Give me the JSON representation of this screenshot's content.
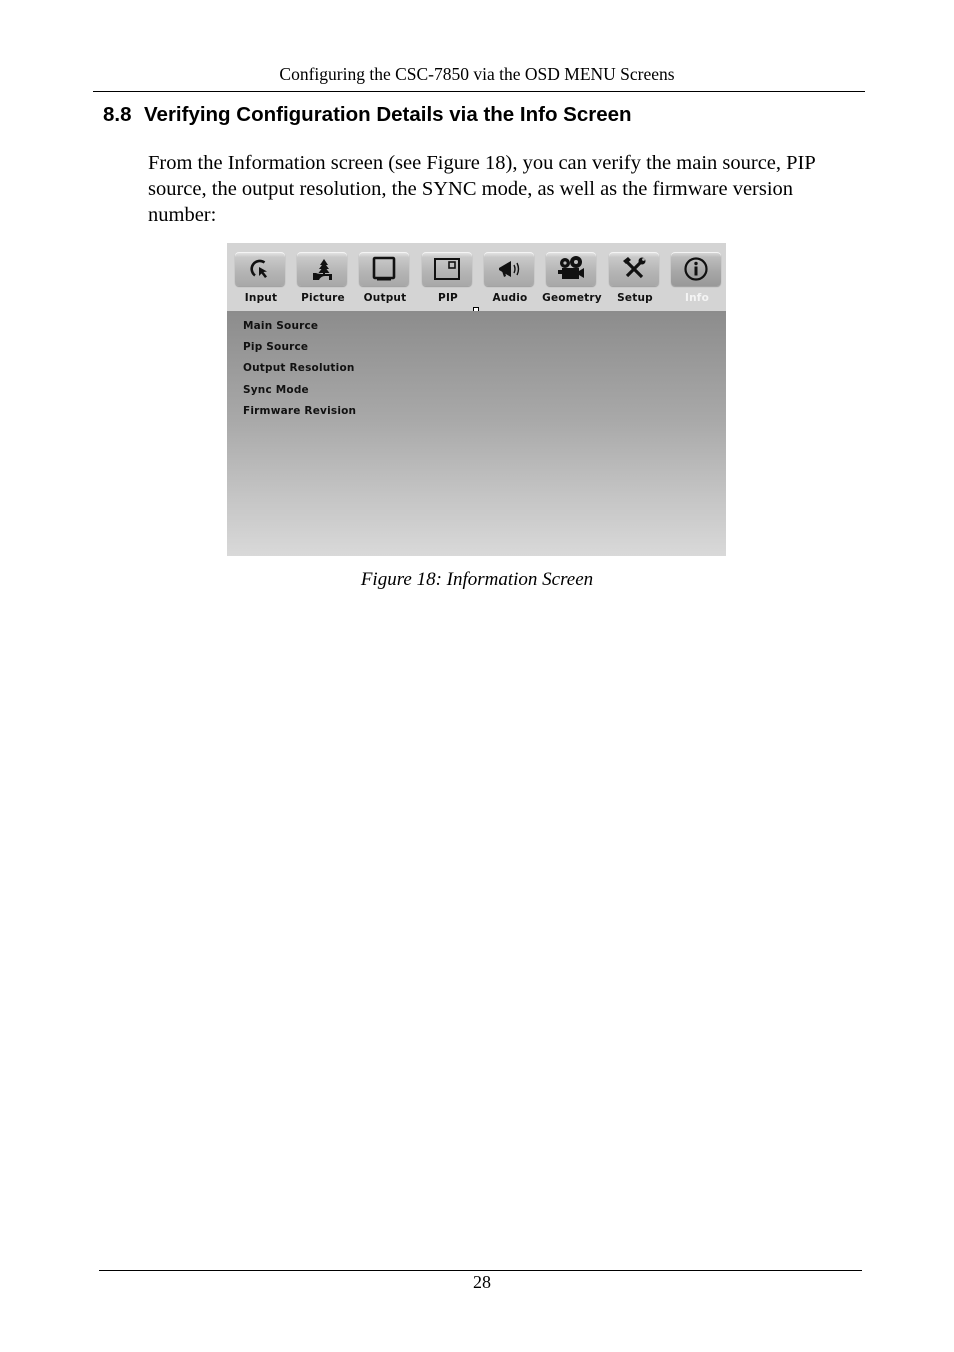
{
  "header": {
    "running_title": "Configuring the CSC-7850 via the OSD MENU Screens"
  },
  "section": {
    "number": "8.8",
    "title": "Verifying Configuration Details via the Info Screen",
    "paragraph": "From the Information screen (see Figure 18), you can verify the main source, PIP source, the output resolution, the SYNC mode, as well as the firmware version number:"
  },
  "osd": {
    "tabs": [
      {
        "label": "Input",
        "icon": "input-cursor-icon"
      },
      {
        "label": "Picture",
        "icon": "picture-landscape-icon"
      },
      {
        "label": "Output",
        "icon": "tv-monitor-icon"
      },
      {
        "label": "PIP",
        "icon": "pip-window-icon"
      },
      {
        "label": "Audio",
        "icon": "megaphone-icon"
      },
      {
        "label": "Geometry",
        "icon": "projector-icon"
      },
      {
        "label": "Setup",
        "icon": "tools-icon"
      },
      {
        "label": "Info",
        "icon": "info-icon",
        "active": true
      }
    ],
    "info_items": [
      "Main Source",
      "Pip Source",
      "Output Resolution",
      "Sync Mode",
      "Firmware Revision"
    ]
  },
  "figure": {
    "caption": "Figure 18: Information Screen"
  },
  "footer": {
    "page_number": "28"
  }
}
